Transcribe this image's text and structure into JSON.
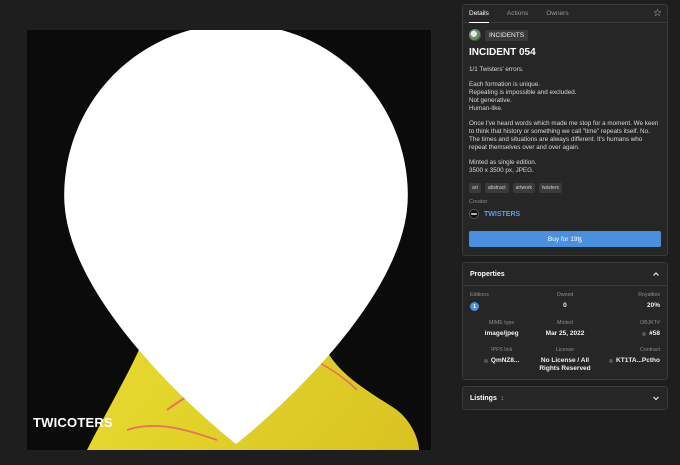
{
  "artwork": {
    "watermark": "TWICOTERS",
    "colors": {
      "background": "#0b0b0b",
      "figure": "#e3d52a",
      "crevice": "#e8705f"
    }
  },
  "tabs": [
    {
      "label": "Details",
      "active": true
    },
    {
      "label": "Actions",
      "active": false
    },
    {
      "label": "Owners",
      "active": false
    }
  ],
  "icons": {
    "favorite": "star-icon",
    "expand": "chevron-icon",
    "location": "pin-icon"
  },
  "details": {
    "collection_badge": "INCIDENTS",
    "title": "INCIDENT 054",
    "description": [
      "1/1 Twisters' errors.",
      "Each formation is unique.\nRepeating is impossible and excluded.\nNot generative.\nHuman-like.",
      "Once I've heard words which made me stop for a moment. We keen to think that history or something we call \"time\" repeats itself. No. The times and situations are always different. It's humans who repeat themselves over and over again.",
      "Minted as single edition.\n3500 x 3500 px, JPEG."
    ],
    "tags": [
      "art",
      "abstract",
      "artwork",
      "twisters"
    ],
    "creator_label": "Creator",
    "creator_name": "TWISTERS",
    "buy_label": "Buy for 19ꜩ"
  },
  "properties": {
    "title": "Properties",
    "editions": {
      "label": "Editions",
      "value": "1"
    },
    "owned": {
      "label": "Owned",
      "value": "0"
    },
    "royalties": {
      "label": "Royalties",
      "value": "20%"
    },
    "mime": {
      "label": "MIME type",
      "value": "image/jpeg"
    },
    "minted": {
      "label": "Minted",
      "value": "Mar 25, 2022"
    },
    "objkt": {
      "label": "OBJKT#",
      "value": "#58"
    },
    "ipfs": {
      "label": "IPFS link",
      "value": "QmNZ8..."
    },
    "license": {
      "label": "License",
      "value": "No License / All Rights Reserved"
    },
    "contract": {
      "label": "Contract",
      "value": "KT1TA...Pctho"
    }
  },
  "listings": {
    "title": "Listings",
    "count": "1"
  },
  "accent": "#4a8fe0"
}
